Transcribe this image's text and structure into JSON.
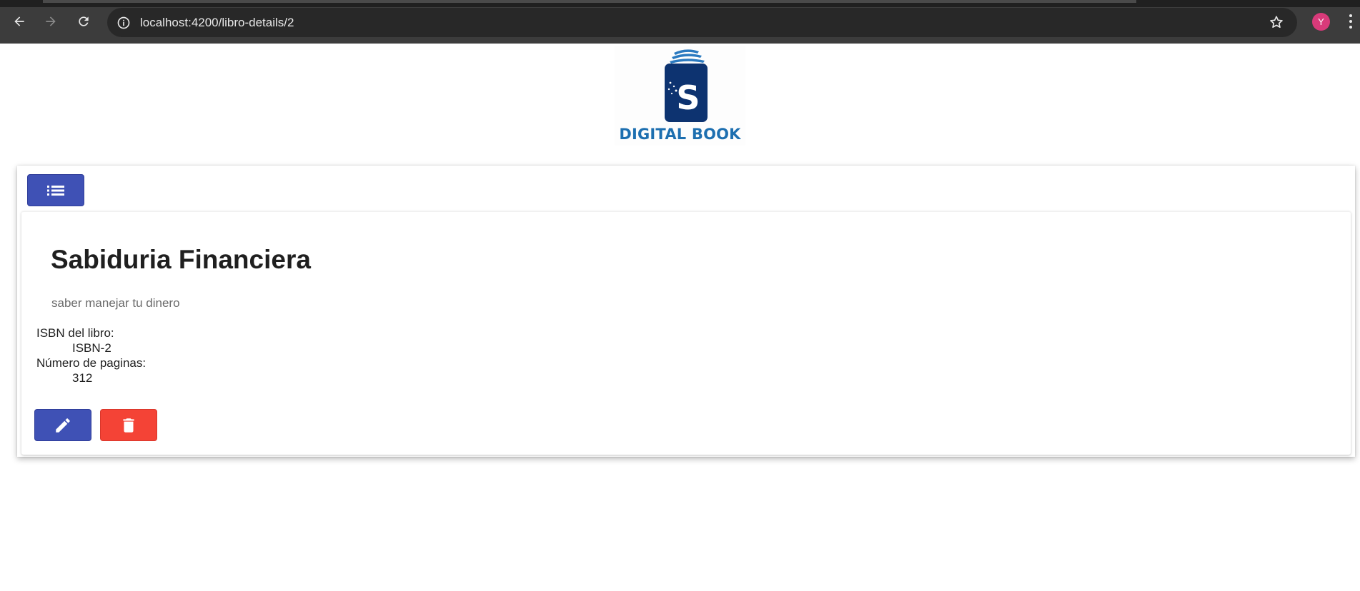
{
  "browser": {
    "url": "localhost:4200/libro-details/2",
    "avatar_initial": "Y",
    "back_icon": "arrow-left-icon",
    "forward_icon": "arrow-right-icon",
    "reload_icon": "reload-icon",
    "site_info_icon": "info-icon",
    "bookmark_icon": "star-icon",
    "menu_icon": "vertical-dots-icon"
  },
  "logo": {
    "text": "DIGITAL BOOK",
    "letter": "S",
    "colors": {
      "book": "#0d3370",
      "pages": "#2b7ac0",
      "text": "#1d6fb0"
    }
  },
  "toolbar": {
    "list_icon": "list-icon"
  },
  "book": {
    "title": "Sabiduria Financiera",
    "description": "saber manejar tu dinero",
    "isbn_label": "ISBN del libro:",
    "isbn_value": "ISBN-2",
    "pages_label": "Número de paginas:",
    "pages_value": "312"
  },
  "actions": {
    "edit_icon": "pencil-icon",
    "delete_icon": "trash-icon"
  },
  "colors": {
    "primary": "#3f51b5",
    "danger": "#f44336",
    "chrome": "#3c3c3c"
  }
}
